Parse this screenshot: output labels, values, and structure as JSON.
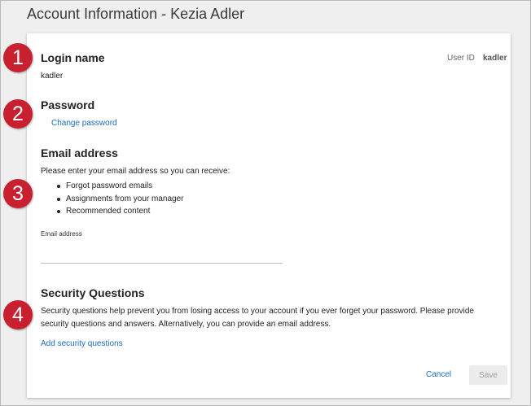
{
  "page": {
    "title": "Account Information - Kezia Adler"
  },
  "login": {
    "heading": "Login name",
    "value": "kadler",
    "user_id_label": "User ID",
    "user_id_value": "kadler"
  },
  "password": {
    "heading": "Password",
    "change_link": "Change password"
  },
  "email": {
    "heading": "Email address",
    "intro": "Please enter your email address so you can receive:",
    "bullets": [
      "Forgot password emails",
      "Assignments from your manager",
      "Recommended content"
    ],
    "field_label": "Email address",
    "field_value": ""
  },
  "security": {
    "heading": "Security Questions",
    "description": "Security questions help prevent you from losing access to your account if you ever forget your password. Please provide security questions and answers. Alternatively, you can provide an email address.",
    "add_link": "Add security questions"
  },
  "actions": {
    "cancel_label": "Cancel",
    "save_label": "Save"
  },
  "callouts": [
    "1",
    "2",
    "3",
    "4"
  ],
  "colors": {
    "accent": "#1a6cc2",
    "badge": "#c8202f"
  }
}
